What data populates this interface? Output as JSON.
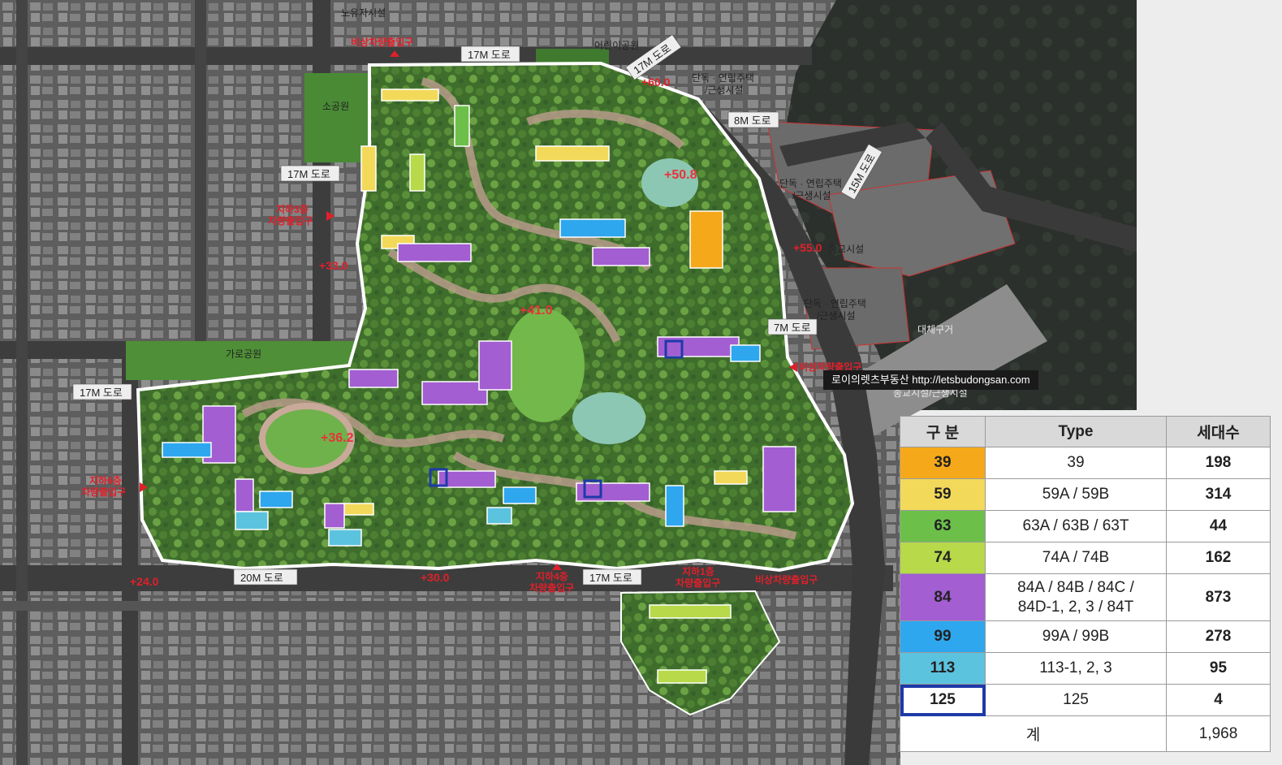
{
  "roads": {
    "top_17m": "17M 도로",
    "left_17m_upper": "17M 도로",
    "left_17m_lower": "17M 도로",
    "ne_17m": "17M 도로",
    "east_8m": "8M 도로",
    "east_15m": "15M 도로",
    "east_7m": "7M 도로",
    "south_20m": "20M 도로",
    "south_17m": "17M 도로"
  },
  "places": {
    "noyuja": "노유자시설",
    "children_park": "어린이공원",
    "small_park": "소공원",
    "street_park": "가로공원",
    "housing_1": "단독 · 연립주택",
    "housing_1_sub": "/근생시설",
    "housing_2": "단독 · 연립주택",
    "housing_2_sub": "/근생시설",
    "religious": "종교시설",
    "housing_3": "단독 · 연립주택",
    "housing_3_sub": "/근생시설",
    "replacement": "대체구거",
    "religious_2": "종교시설/근생시설"
  },
  "elevations": {
    "e60": "+60.0",
    "e55": "+55.0",
    "e508": "+50.8",
    "e41": "+41.0",
    "e362": "+36.2",
    "e33": "+33.0",
    "e24": "+24.0",
    "e30": "+30.0"
  },
  "entrances": {
    "emergency_top": "비상차량출입구",
    "b3_line1": "지하3층",
    "b3_line2": "차량출입구",
    "b6_line1": "지하6층",
    "b6_line2": "차량출입구",
    "b4_line1": "지하4층",
    "b4_line2": "차량출입구",
    "b1_line1": "지하1층",
    "b1_line2": "차량출입구",
    "emergency_bottom": "비상차량출입구",
    "emergency_east": "비상차량출입구"
  },
  "colors": {
    "t39": "#f5a91a",
    "t59": "#f3d95a",
    "t63": "#6cc04a",
    "t74": "#b7d94a",
    "t84": "#a35ed2",
    "t99": "#2ea7ef",
    "t113": "#5cc3df",
    "t125": "#ffffff",
    "t125_border": "#1d3aa8"
  },
  "watermark": "로이의렛츠부동산 http://letsbudongsan.com",
  "table": {
    "headers": [
      "구 분",
      "Type",
      "세대수"
    ],
    "rows": [
      {
        "code": "39",
        "type": "39",
        "count": "198",
        "color": "#f5a91a"
      },
      {
        "code": "59",
        "type": "59A / 59B",
        "count": "314",
        "color": "#f3d95a"
      },
      {
        "code": "63",
        "type": "63A / 63B / 63T",
        "count": "44",
        "color": "#6cc04a"
      },
      {
        "code": "74",
        "type": "74A / 74B",
        "count": "162",
        "color": "#b7d94a"
      },
      {
        "code": "84",
        "type": "84A / 84B / 84C / 84D-1, 2, 3 / 84T",
        "count": "873",
        "color": "#a35ed2"
      },
      {
        "code": "99",
        "type": "99A / 99B",
        "count": "278",
        "color": "#2ea7ef"
      },
      {
        "code": "113",
        "type": "113-1, 2, 3",
        "count": "95",
        "color": "#5cc3df"
      },
      {
        "code": "125",
        "type": "125",
        "count": "4",
        "color": "#ffffff"
      }
    ],
    "total_label": "계",
    "total_count": "1,968"
  }
}
